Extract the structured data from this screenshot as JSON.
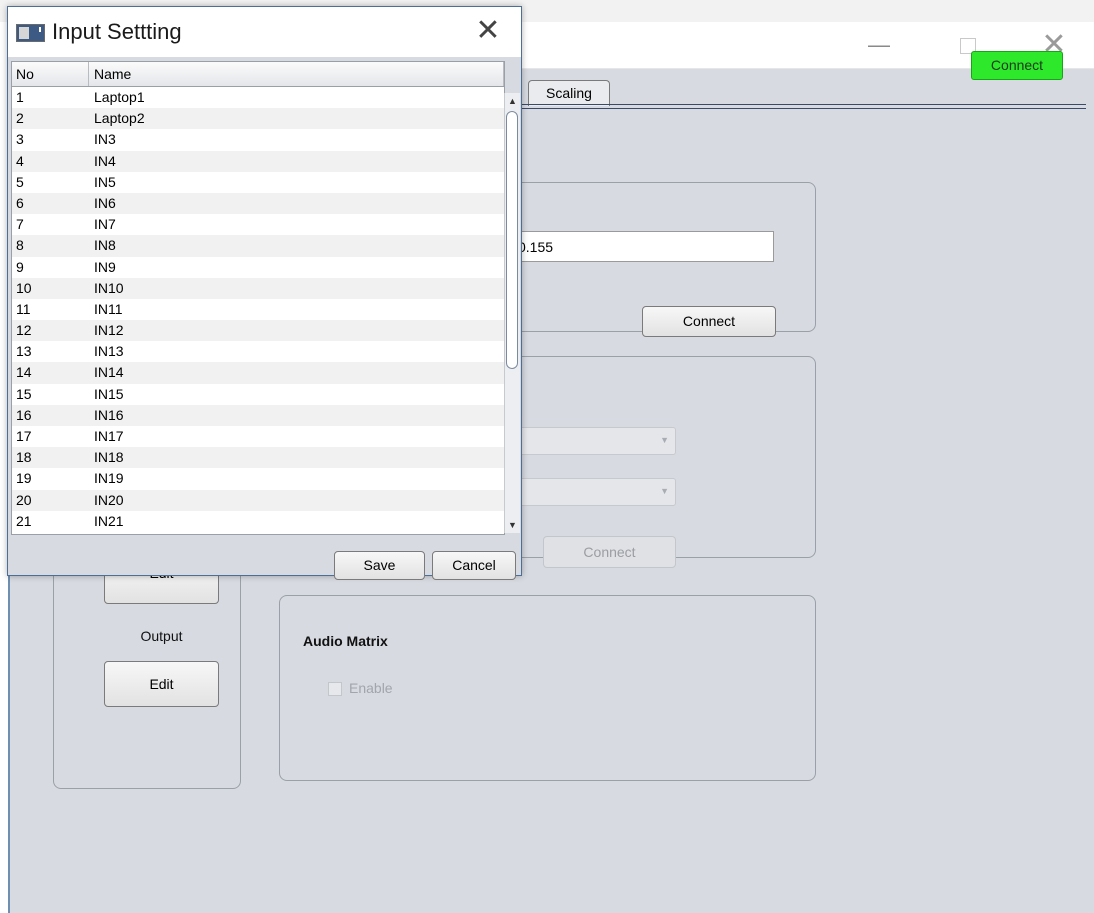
{
  "main_window": {
    "minimize_glyph": "—",
    "close_glyph": "✕",
    "top_connect_label": "Connect",
    "tab_scaling_label": "Scaling",
    "ip_value": "0.155",
    "network_connect_label": "Connect",
    "control_connect_label": "Connect",
    "combo_arrow": "▼",
    "input_edit_label": "Edit",
    "output_label": "Output",
    "output_edit_label": "Edit",
    "audio_matrix_title": "Audio Matrix",
    "enable_label": "Enable",
    "colors": {
      "connect_green": "#2ee82b",
      "panel_bg": "#d7dae1",
      "frame_border": "#6f8fb0"
    }
  },
  "dialog": {
    "title": "Input Settting",
    "close_glyph": "✕",
    "columns": {
      "no": "No",
      "name": "Name"
    },
    "rows": [
      {
        "no": "1",
        "name": "Laptop1"
      },
      {
        "no": "2",
        "name": "Laptop2"
      },
      {
        "no": "3",
        "name": "IN3"
      },
      {
        "no": "4",
        "name": "IN4"
      },
      {
        "no": "5",
        "name": "IN5"
      },
      {
        "no": "6",
        "name": "IN6"
      },
      {
        "no": "7",
        "name": "IN7"
      },
      {
        "no": "8",
        "name": "IN8"
      },
      {
        "no": "9",
        "name": "IN9"
      },
      {
        "no": "10",
        "name": "IN10"
      },
      {
        "no": "11",
        "name": "IN11"
      },
      {
        "no": "12",
        "name": "IN12"
      },
      {
        "no": "13",
        "name": "IN13"
      },
      {
        "no": "14",
        "name": "IN14"
      },
      {
        "no": "15",
        "name": "IN15"
      },
      {
        "no": "16",
        "name": "IN16"
      },
      {
        "no": "17",
        "name": "IN17"
      },
      {
        "no": "18",
        "name": "IN18"
      },
      {
        "no": "19",
        "name": "IN19"
      },
      {
        "no": "20",
        "name": "IN20"
      },
      {
        "no": "21",
        "name": "IN21"
      }
    ],
    "scroll_up_glyph": "▲",
    "scroll_down_glyph": "▼",
    "save_label": "Save",
    "cancel_label": "Cancel"
  }
}
